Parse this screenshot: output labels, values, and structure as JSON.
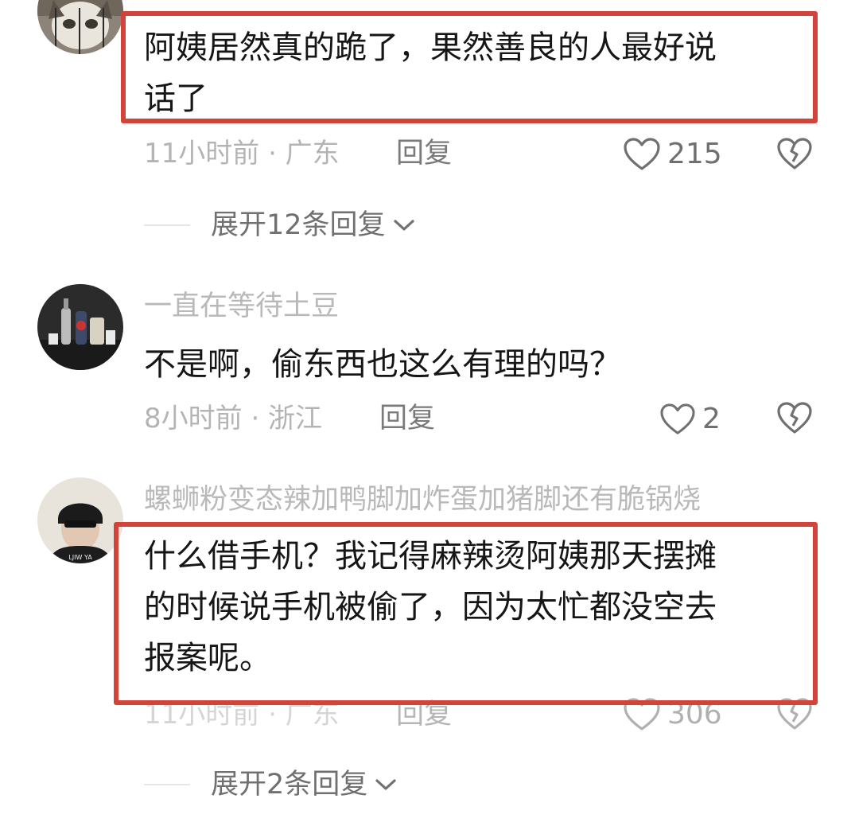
{
  "comments": [
    {
      "text_lines": [
        "阿姨居然真的跪了，果然善良的人最好说",
        "话了"
      ],
      "time_location": "11小时前 · 广东",
      "reply_label": "回复",
      "likes": "215",
      "expand_label": "展开12条回复"
    },
    {
      "username": "一直在等待土豆",
      "text_lines": [
        "不是啊，偷东西也这么有理的吗？"
      ],
      "time_location": "8小时前 · 浙江",
      "reply_label": "回复",
      "likes": "2"
    },
    {
      "username": "螺蛳粉变态辣加鸭脚加炸蛋加猪脚还有脆锅烧",
      "text_lines": [
        "什么借手机？我记得麻辣烫阿姨那天摆摊",
        "的时候说手机被偷了，因为太忙都没空去",
        "报案呢。"
      ],
      "time_location": "11小时前 · 广东",
      "reply_label": "回复",
      "likes": "306",
      "expand_label": "展开2条回复",
      "avatar_shirt_text": "LJIW YA"
    }
  ],
  "colors": {
    "highlight": "#d2433a",
    "username": "#b9b9b9",
    "comment_text": "#161616",
    "meta": "#b4b4b4"
  },
  "icons": [
    "heart-outline-icon",
    "broken-heart-icon",
    "chevron-down-icon"
  ]
}
